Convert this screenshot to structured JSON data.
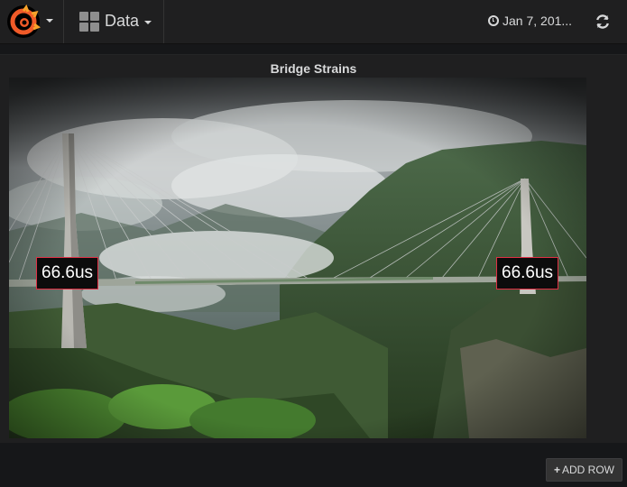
{
  "navbar": {
    "dashboard_title": "Data",
    "time_range": "Jan 7, 201..."
  },
  "panel": {
    "title": "Bridge Strains",
    "labels": [
      {
        "value": "66.6us"
      },
      {
        "value": "66.6us"
      }
    ]
  },
  "footer": {
    "add_row_label": "ADD ROW"
  },
  "colors": {
    "threshold_border": "#e02f44",
    "logo_orange": "#f05a28"
  }
}
